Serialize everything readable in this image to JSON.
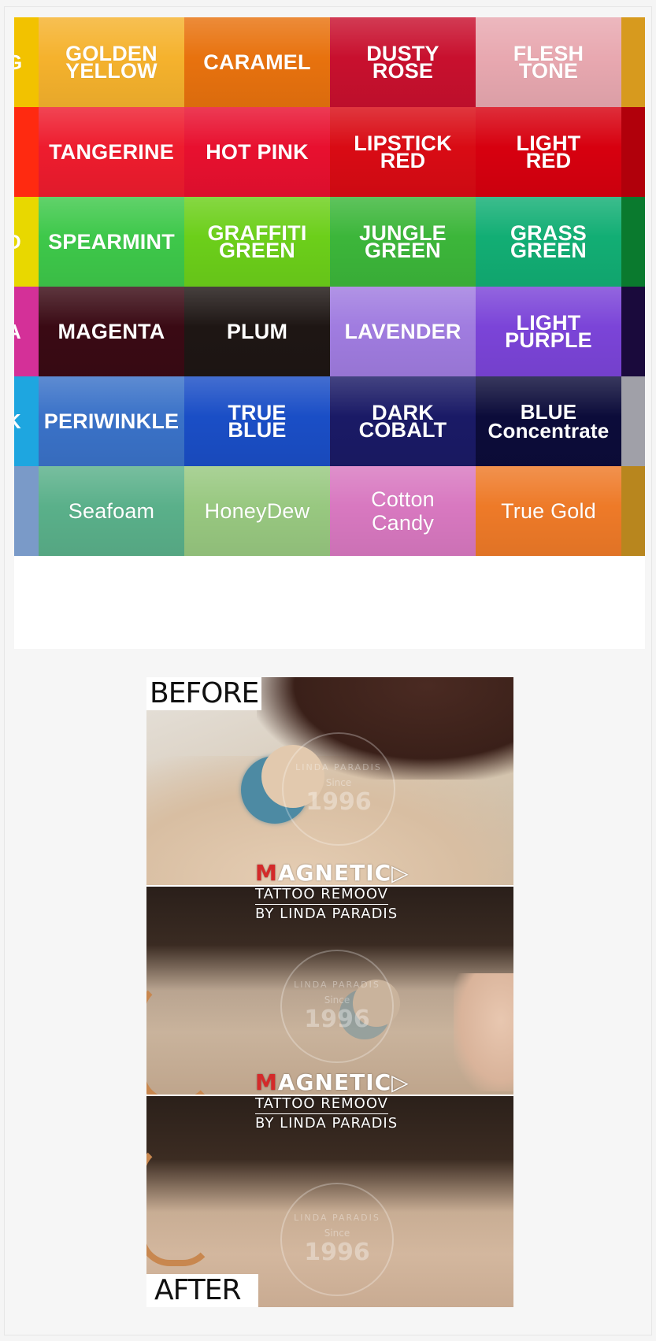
{
  "color_chart": {
    "rows": [
      {
        "left_sliver": {
          "label": "G",
          "color": "#f2c200"
        },
        "cells": [
          {
            "label": "GOLDEN\nYELLOW",
            "color": "#f5b22d",
            "style": "caps"
          },
          {
            "label": "CARAMEL",
            "color": "#e8720e",
            "style": "caps"
          },
          {
            "label": "DUSTY\nROSE",
            "color": "#c8102e",
            "style": "caps"
          },
          {
            "label": "FLESH\nTONE",
            "color": "#e8a8b0",
            "style": "caps"
          }
        ],
        "right_sliver_color": "#d79a1e"
      },
      {
        "left_sliver": {
          "label": "",
          "color": "#ff2a10"
        },
        "cells": [
          {
            "label": "TANGERINE",
            "color": "#ee1c2e",
            "style": "caps"
          },
          {
            "label": "HOT PINK",
            "color": "#e8102f",
            "style": "caps"
          },
          {
            "label": "LIPSTICK\nRED",
            "color": "#d90b14",
            "style": "caps"
          },
          {
            "label": "LIGHT\nRED",
            "color": "#d7000f",
            "style": "caps"
          }
        ],
        "right_sliver_color": "#b1000b"
      },
      {
        "left_sliver": {
          "label": "D",
          "color": "#e8d800"
        },
        "cells": [
          {
            "label": "SPEARMINT",
            "color": "#3ec84a",
            "style": "caps"
          },
          {
            "label": "GRAFFITI\nGREEN",
            "color": "#6ccf1a",
            "style": "caps"
          },
          {
            "label": "JUNGLE\nGREEN",
            "color": "#3cb63a",
            "style": "caps"
          },
          {
            "label": "GRASS\nGREEN",
            "color": "#12ae74",
            "style": "caps"
          }
        ],
        "right_sliver_color": "#0a7a2e"
      },
      {
        "left_sliver": {
          "label": "A",
          "color": "#d43098"
        },
        "cells": [
          {
            "label": "MAGENTA",
            "color": "#3a0a14",
            "style": "caps"
          },
          {
            "label": "PLUM",
            "color": "#1e1614",
            "style": "caps"
          },
          {
            "label": "LAVENDER",
            "color": "#a07ce0",
            "style": "caps"
          },
          {
            "label": "LIGHT\nPURPLE",
            "color": "#7b44d8",
            "style": "caps"
          }
        ],
        "right_sliver_color": "#1a0a3c"
      },
      {
        "left_sliver": {
          "label": "K",
          "color": "#1ea6e0"
        },
        "cells": [
          {
            "label": "PERIWINKLE",
            "color": "#3a72c8",
            "style": "caps"
          },
          {
            "label": "TRUE\nBLUE",
            "color": "#1a4ec6",
            "style": "caps"
          },
          {
            "label": "DARK\nCOBALT",
            "color": "#1a1a66",
            "style": "caps"
          },
          {
            "label": "BLUE\nConcentrate",
            "color": "#0c0c3a",
            "style": "mixed"
          }
        ],
        "right_sliver_color": "#a0a0a8"
      },
      {
        "left_sliver": {
          "label": "",
          "color": "#7a9ac8"
        },
        "cells": [
          {
            "label": "Seafoam",
            "color": "#5ab08a",
            "style": "normal"
          },
          {
            "label": "HoneyDew",
            "color": "#98c880",
            "style": "normal"
          },
          {
            "label": "Cotton\nCandy",
            "color": "#d878c0",
            "style": "normal"
          },
          {
            "label": "True Gold",
            "color": "#ee7a28",
            "style": "normal"
          }
        ],
        "right_sliver_color": "#b8861e"
      }
    ]
  },
  "before_after": {
    "before_label": "BEFORE",
    "after_label": "AFTER",
    "logo": {
      "brand": "AGNETIC",
      "brand_initial": "M",
      "brand_arrow": "▷",
      "line2": "TATTOO REMOOV",
      "line3": "BY LINDA PARADIS"
    },
    "watermark": {
      "name": "LINDA PARADIS",
      "since": "Since",
      "year": "1996"
    }
  }
}
